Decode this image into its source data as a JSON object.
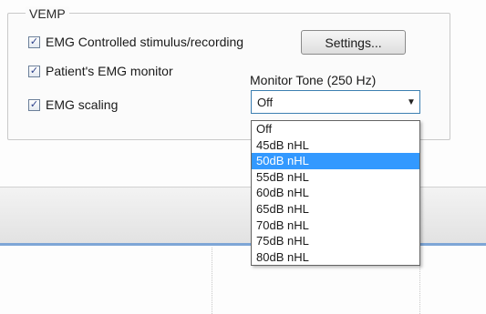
{
  "group": {
    "title": "VEMP"
  },
  "checkboxes": [
    {
      "label": "EMG Controlled stimulus/recording",
      "checked": true
    },
    {
      "label": "Patient's EMG monitor",
      "checked": true
    },
    {
      "label": "EMG scaling",
      "checked": true
    }
  ],
  "settings_button": "Settings...",
  "monitor_tone": {
    "label": "Monitor Tone (250 Hz)",
    "selected": "Off",
    "options": [
      "Off",
      "45dB nHL",
      "50dB nHL",
      "55dB nHL",
      "60dB nHL",
      "65dB nHL",
      "70dB nHL",
      "75dB nHL",
      "80dB nHL"
    ],
    "highlighted": "50dB nHL"
  },
  "icons": {
    "check": "✓",
    "combo_arrow": "▼"
  },
  "colors": {
    "highlight": "#3399ff",
    "accent_line": "#7ea6d6"
  }
}
